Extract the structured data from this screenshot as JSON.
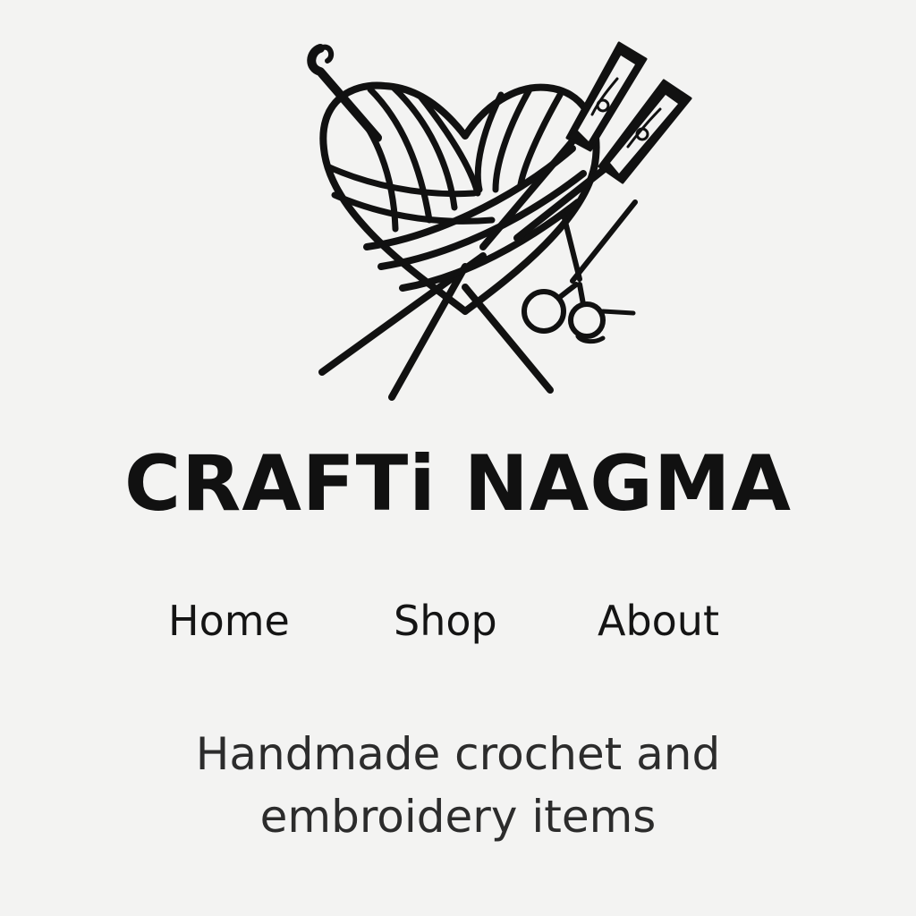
{
  "brand": {
    "name": "CRAFTi NAGMA",
    "logo_icon": "yarn-heart-with-needles-and-scissors-icon"
  },
  "nav": {
    "items": [
      {
        "label": "Home"
      },
      {
        "label": "Shop"
      },
      {
        "label": "About"
      }
    ]
  },
  "tagline": "Handmade crochet and embroidery items",
  "colors": {
    "background": "#f3f3f2",
    "text": "#141414",
    "tagline": "#2c2c2c"
  }
}
